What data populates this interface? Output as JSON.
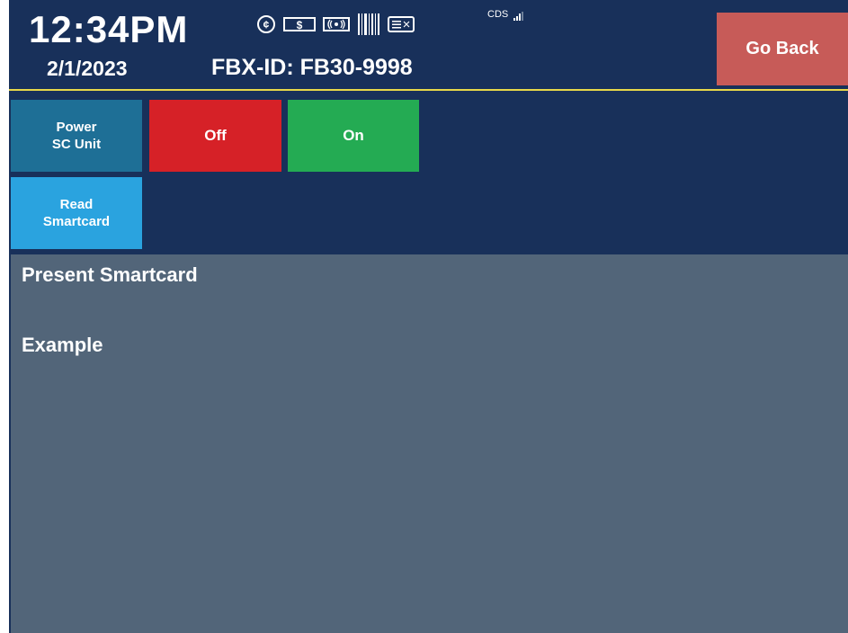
{
  "status_bar": {
    "time": "12:34PM",
    "date": "2/1/2023",
    "fbx_id": "FBX-ID: FB30-9998",
    "cds_label": "CDS",
    "icons": [
      "coin-icon",
      "cash-icon",
      "contactless-icon",
      "barcode-icon",
      "card-reader-icon",
      "signal-icon"
    ]
  },
  "nav": {
    "go_back_label": "Go Back"
  },
  "controls": {
    "power_label_line1": "Power",
    "power_label_line2": "SC Unit",
    "off_label": "Off",
    "on_label": "On",
    "read_label_line1": "Read",
    "read_label_line2": "Smartcard"
  },
  "messages": {
    "line1": "Present Smartcard",
    "line2": "Example"
  },
  "colors": {
    "background": "#18305a",
    "accent_line": "#e8d84a",
    "go_back": "#c75b58",
    "power": "#1e6f96",
    "off": "#d62127",
    "on": "#24ab53",
    "read": "#2aa3df",
    "content_panel": "#526579"
  }
}
